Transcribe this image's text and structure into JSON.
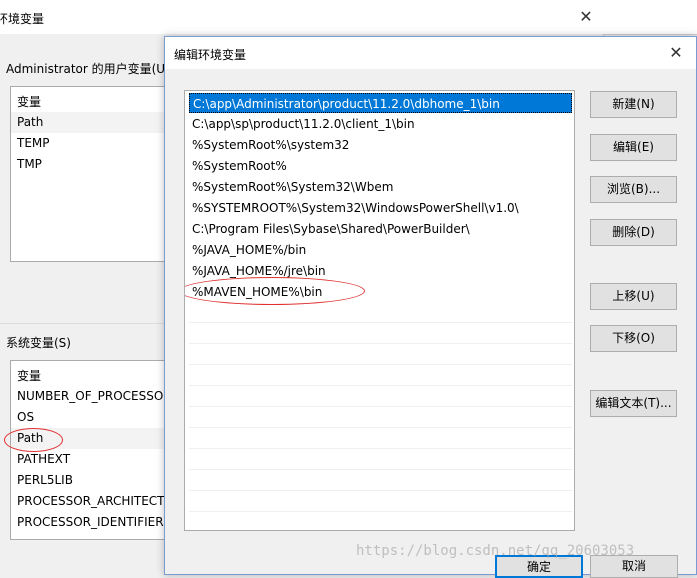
{
  "bg_window": {
    "title": "环境变量",
    "user_section_label": "Administrator 的用户变量(U)",
    "user_vars_header": "变量",
    "user_vars": [
      "Path",
      "TEMP",
      "TMP"
    ],
    "system_section_label": "系统变量(S)",
    "system_vars_header": "变量",
    "system_vars": [
      "NUMBER_OF_PROCESSORS",
      "OS",
      "Path",
      "PATHEXT",
      "PERL5LIB",
      "PROCESSOR_ARCHITECT...",
      "PROCESSOR_IDENTIFIER"
    ]
  },
  "dialog": {
    "title": "编辑环境变量",
    "paths": [
      "C:\\app\\Administrator\\product\\11.2.0\\dbhome_1\\bin",
      "C:\\app\\sp\\product\\11.2.0\\client_1\\bin",
      "%SystemRoot%\\system32",
      "%SystemRoot%",
      "%SystemRoot%\\System32\\Wbem",
      "%SYSTEMROOT%\\System32\\WindowsPowerShell\\v1.0\\",
      "C:\\Program Files\\Sybase\\Shared\\PowerBuilder\\",
      "%JAVA_HOME%/bin",
      "%JAVA_HOME%/jre\\bin",
      "%MAVEN_HOME%\\bin"
    ],
    "buttons": {
      "new": "新建(N)",
      "edit": "编辑(E)",
      "browse": "浏览(B)...",
      "delete": "删除(D)",
      "move_up": "上移(U)",
      "move_down": "下移(O)",
      "edit_text": "编辑文本(T)...",
      "ok": "确定",
      "cancel": "取消"
    }
  },
  "watermark": "https://blog.csdn.net/qq_20603053",
  "colors": {
    "selection": "#0078d7",
    "annotation": "#e03030"
  }
}
